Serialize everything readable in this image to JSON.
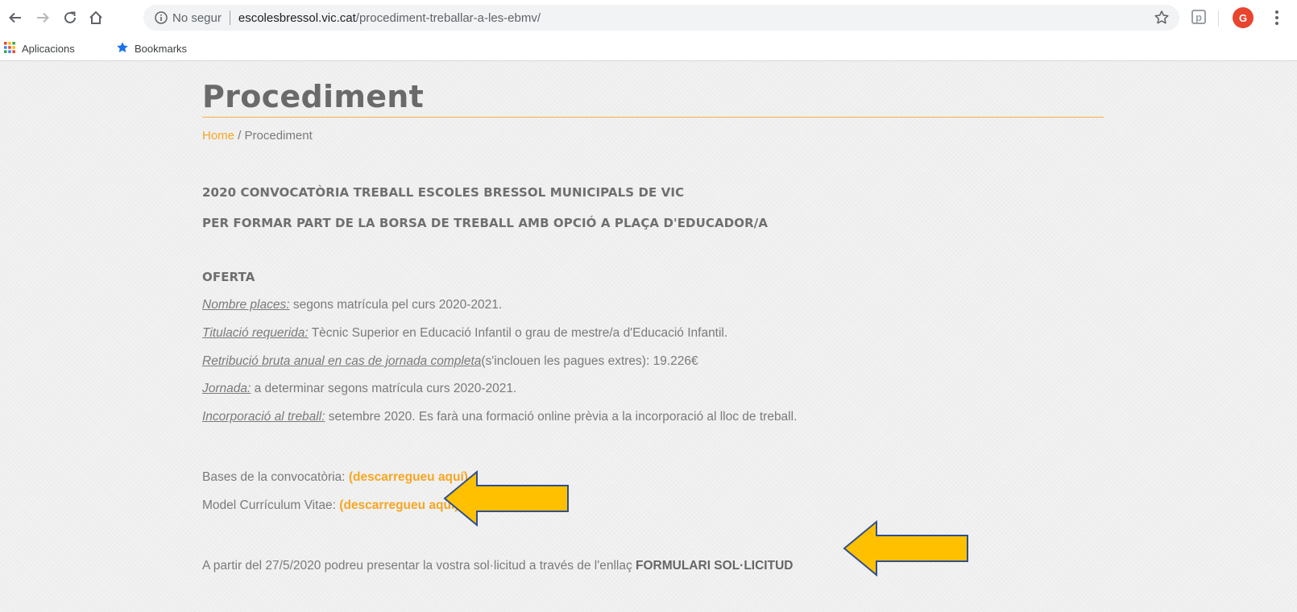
{
  "browser": {
    "security_label": "No segur",
    "url_host": "escolesbressol.vic.cat",
    "url_path": "/procediment-treballar-a-les-ebmv/",
    "extension_label": "p",
    "profile_initial": "G",
    "bookmarks": [
      {
        "label": "Aplicacions",
        "icon": "apps-grid-icon"
      },
      {
        "label": "Bookmarks",
        "icon": "star-icon"
      }
    ]
  },
  "page": {
    "title": "Procediment",
    "breadcrumb": {
      "home": "Home",
      "separator": " / ",
      "current": "Procediment"
    },
    "headings": [
      "2020 CONVOCATÒRIA TREBALL ESCOLES BRESSOL MUNICIPALS DE VIC",
      "PER FORMAR PART DE LA BORSA DE TREBALL AMB OPCIÓ A PLAÇA D'EDUCADOR/A"
    ],
    "offer_heading": "OFERTA",
    "offer_items": [
      {
        "key": "Nombre places:",
        "text": " segons matrícula pel curs 2020-2021."
      },
      {
        "key": "Titulació requerida:",
        "text": " Tècnic Superior en Educació Infantil o grau de mestre/a d'Educació Infantil."
      },
      {
        "key": "Retribució bruta anual en cas de jornada completa",
        "text": "(s'inclouen les pagues extres): 19.226€"
      },
      {
        "key": "Jornada:",
        "text": " a determinar segons matrícula curs 2020-2021."
      },
      {
        "key": "Incorporació al treball:",
        "text": " setembre 2020. Es farà una formació online prèvia a la incorporació al lloc de treball."
      }
    ],
    "downloads": [
      {
        "label": "Bases de la convocatòria: ",
        "link": "(descarregueu aquí)"
      },
      {
        "label": "Model Currículum Vitae: ",
        "link": "(descarregueu aquí)"
      }
    ],
    "final_text": "A partir del 27/5/2020 podreu presentar la vostra sol·licitud a través de l'enllaç ",
    "final_link": "FORMULARI  SOL·LICITUD"
  },
  "colors": {
    "accent": "#f6a623",
    "arrow_fill": "#ffc000",
    "arrow_stroke": "#2f4f8f"
  }
}
